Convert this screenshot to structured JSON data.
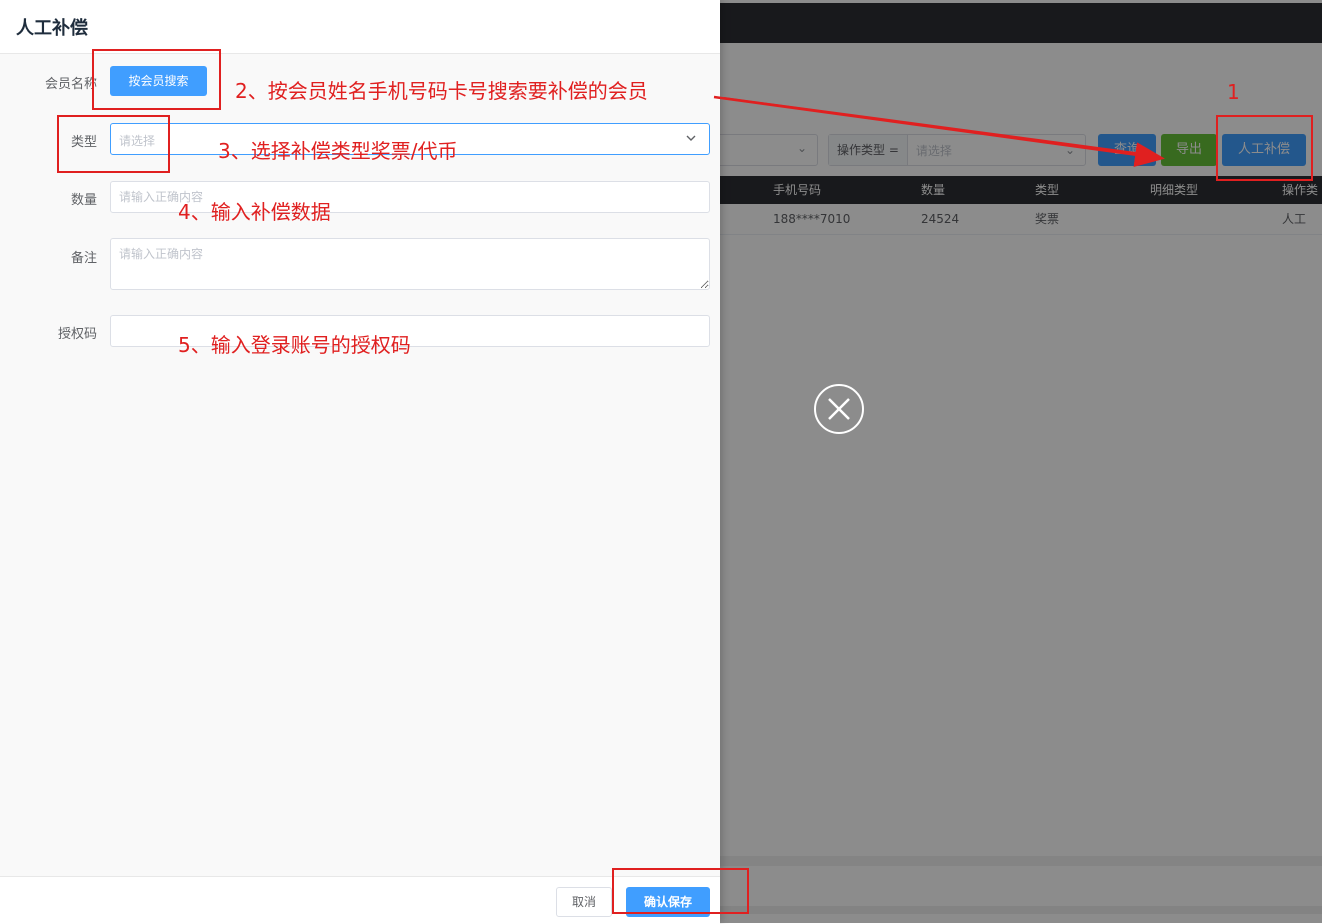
{
  "drawer": {
    "title": "人工补偿",
    "form": {
      "member": {
        "label": "会员名称",
        "button": "按会员搜索"
      },
      "type": {
        "label": "类型",
        "placeholder": "请选择"
      },
      "quantity": {
        "label": "数量",
        "placeholder": "请输入正确内容"
      },
      "remark": {
        "label": "备注",
        "placeholder": "请输入正确内容"
      },
      "auth_code": {
        "label": "授权码",
        "placeholder": ""
      }
    },
    "footer": {
      "cancel": "取消",
      "save": "确认保存"
    }
  },
  "background": {
    "filter": {
      "op_type_label": "操作类型 =",
      "op_type_placeholder": "请选择",
      "buttons": {
        "query": "查询",
        "export": "导出",
        "manual": "人工补偿"
      }
    },
    "table": {
      "headers": [
        "手机号码",
        "数量",
        "类型",
        "明细类型",
        "操作类型"
      ],
      "rows": [
        {
          "phone": "188****7010",
          "quantity": "24524",
          "type": "奖票",
          "detail_type": "",
          "op_type": "人工"
        }
      ]
    }
  },
  "annotations": {
    "step1": "1",
    "step2": "2、按会员姓名手机号码卡号搜索要补偿的会员",
    "step3": "3、选择补偿类型奖票/代币",
    "step4": "4、输入补偿数据",
    "step5": "5、输入登录账号的授权码",
    "color": "#e02020"
  },
  "colors": {
    "primary": "#409eff",
    "success": "#67c23a",
    "header_dark": "#2d2f33"
  },
  "icons": {
    "close": "close-circle-icon",
    "dropdown": "chevron-down-icon"
  }
}
